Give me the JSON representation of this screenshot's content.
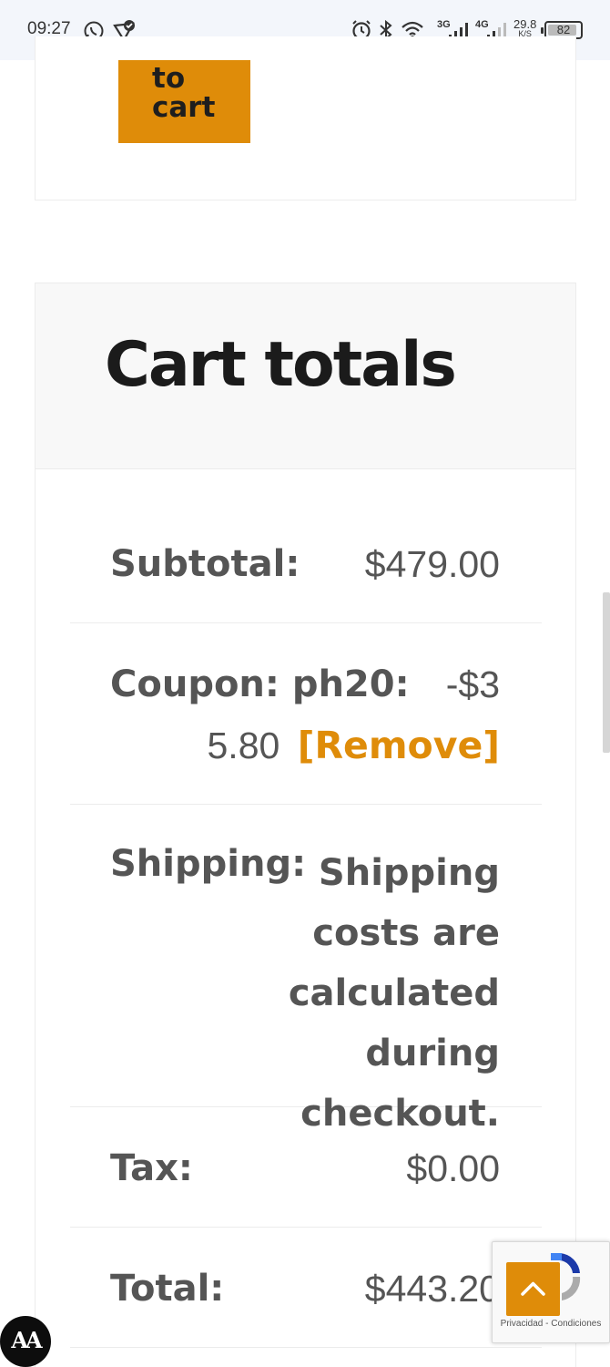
{
  "status_bar": {
    "time": "09:27",
    "icons": [
      "whatsapp-icon",
      "location-check-icon",
      "alarm-icon",
      "bluetooth-icon",
      "wifi-icon"
    ],
    "network_1": "3G",
    "network_2": "4G",
    "speed_value": "29.8",
    "speed_unit": "K/S",
    "battery": "82"
  },
  "product": {
    "add_to_cart_line1": "to",
    "add_to_cart_line2": "cart"
  },
  "cart_totals": {
    "title": "Cart totals",
    "subtotal_label": "Subtotal:",
    "subtotal_value": "$479.00",
    "coupon_label": "Coupon: ph20:",
    "coupon_value_part1": "-$3",
    "coupon_value_part2": "5.80",
    "remove_label": "[Remove]",
    "shipping_label": "Shipping:",
    "shipping_text": "Shipping costs are calculated during checkout.",
    "tax_label": "Tax:",
    "tax_value": "$0.00",
    "total_label": "Total:",
    "total_value": "$443.20"
  },
  "recaptcha": {
    "privacy": "Privacidad",
    "separator": "-",
    "terms": "Condiciones"
  },
  "accessibility": {
    "label": "AA"
  },
  "colors": {
    "accent": "#df8c09",
    "text": "#555555",
    "title": "#1b1b1b"
  }
}
